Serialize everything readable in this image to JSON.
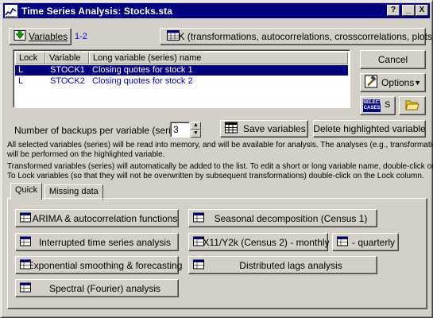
{
  "window": {
    "title": "Time Series Analysis: Stocks.sta",
    "titlebar_buttons": [
      "?",
      "_",
      "X"
    ]
  },
  "header": {
    "variables_button": "Variables",
    "variables_range": "1-2",
    "ok_button": "OK (transformations, autocorrelations, crosscorrelations, plots)"
  },
  "variable_list": {
    "columns": [
      "Lock",
      "Variable",
      "Long variable (series) name"
    ],
    "rows": [
      {
        "lock": "L",
        "variable": "STOCK1",
        "name": "Closing quotes for stock 1",
        "selected": true
      },
      {
        "lock": "L",
        "variable": "STOCK2",
        "name": "Closing quotes for stock 2",
        "selected": false
      }
    ]
  },
  "side": {
    "cancel_button": "Cancel",
    "options_button": "Options",
    "select_cases_line1": "SELECT",
    "select_cases_line2": "CASES",
    "select_cases_symbol": "S"
  },
  "backups": {
    "label": "Number of backups per variable (series):",
    "value": "3",
    "save_button": "Save variables",
    "delete_button": "Delete highlighted variable"
  },
  "info_text": [
    "All selected variables (series) will be read into memory, and will be available for analysis. The analyses (e.g., transformations)",
    "will be performed on the highlighted variable.",
    "Transformed variables (series) will automatically be added to the list. To edit a short or long variable name, double-click on it.",
    "To Lock variables (so that they will not be overwritten by subsequent transformations) double-click on the Lock column."
  ],
  "tabs": [
    {
      "label": "Quick",
      "active": true
    },
    {
      "label": "Missing data",
      "active": false
    }
  ],
  "quick_buttons": {
    "arima": "ARIMA & autocorrelation functions",
    "seasonal": "Seasonal decomposition (Census 1)",
    "interrupted": "Interrupted time series analysis",
    "x11_monthly": "X11/Y2k (Census 2) - monthly",
    "quarterly": "- quarterly",
    "exponential": "Exponential smoothing & forecasting",
    "distributed": "Distributed lags analysis",
    "spectral": "Spectral (Fourier) analysis"
  },
  "colors": {
    "title_bar": "#000080",
    "face": "#d4d0c8",
    "list_text": "#0000cc",
    "selection": "#000080",
    "range_text": "#0000ff"
  }
}
